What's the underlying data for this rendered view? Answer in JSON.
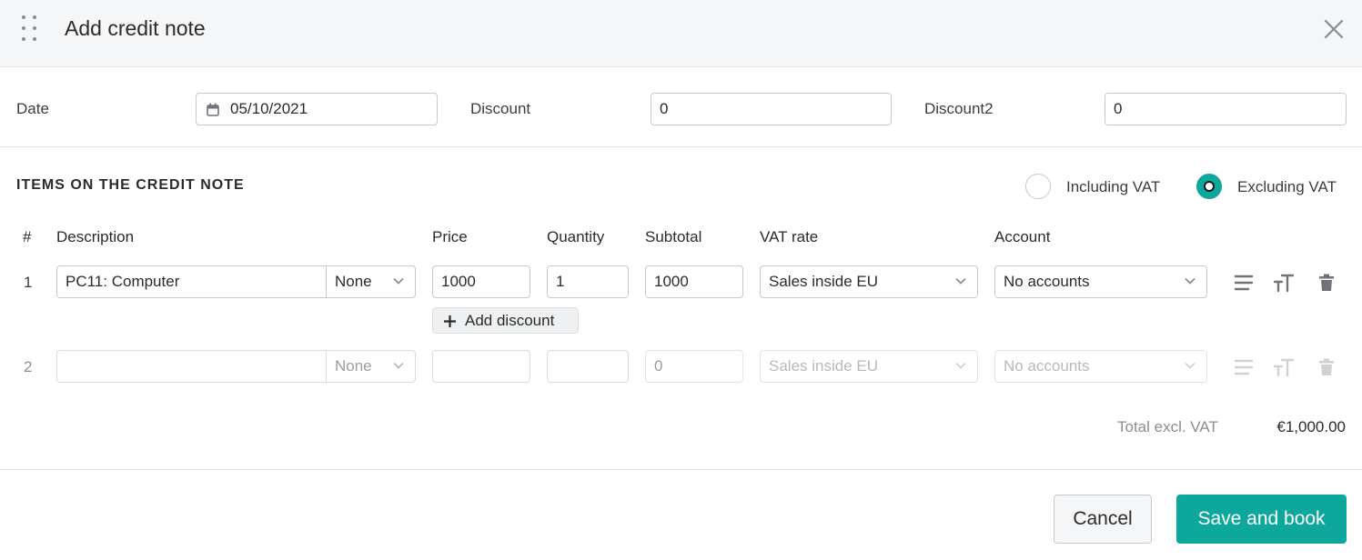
{
  "dialog": {
    "title": "Add credit note"
  },
  "fields": {
    "date_label": "Date",
    "date_value": "05/10/2021",
    "discount_label": "Discount",
    "discount_value": "0",
    "discount2_label": "Discount2",
    "discount2_value": "0"
  },
  "items": {
    "section_title": "ITEMS ON THE CREDIT NOTE",
    "vat_options": [
      {
        "label": "Including VAT",
        "selected": false
      },
      {
        "label": "Excluding VAT",
        "selected": true
      }
    ],
    "columns": [
      "#",
      "Description",
      "Price",
      "Quantity",
      "Subtotal",
      "VAT rate",
      "Account"
    ],
    "rows": [
      {
        "num": "1",
        "description": "PC11: Computer",
        "unit": "None",
        "price": "1000",
        "quantity": "1",
        "subtotal": "1000",
        "vat_rate": "Sales inside EU",
        "account": "No accounts"
      },
      {
        "num": "2",
        "description": "",
        "unit": "None",
        "price": "",
        "quantity": "",
        "subtotal": "0",
        "vat_rate": "Sales inside EU",
        "account": "No accounts"
      }
    ],
    "add_discount_label": "Add discount"
  },
  "totals": {
    "label": "Total excl. VAT",
    "value": "€1,000.00"
  },
  "footer": {
    "cancel_label": "Cancel",
    "save_label": "Save and book"
  },
  "colors": {
    "accent": "#0ea79c",
    "header_bg": "#f5f6f7"
  },
  "icons": {
    "drag": "drag-handle-icon",
    "close": "close-icon",
    "calendar": "calendar-icon",
    "chevron": "chevron-down-icon",
    "plus": "plus-icon",
    "lines": "lines-icon",
    "text_size": "text-size-icon",
    "trash": "trash-icon"
  }
}
